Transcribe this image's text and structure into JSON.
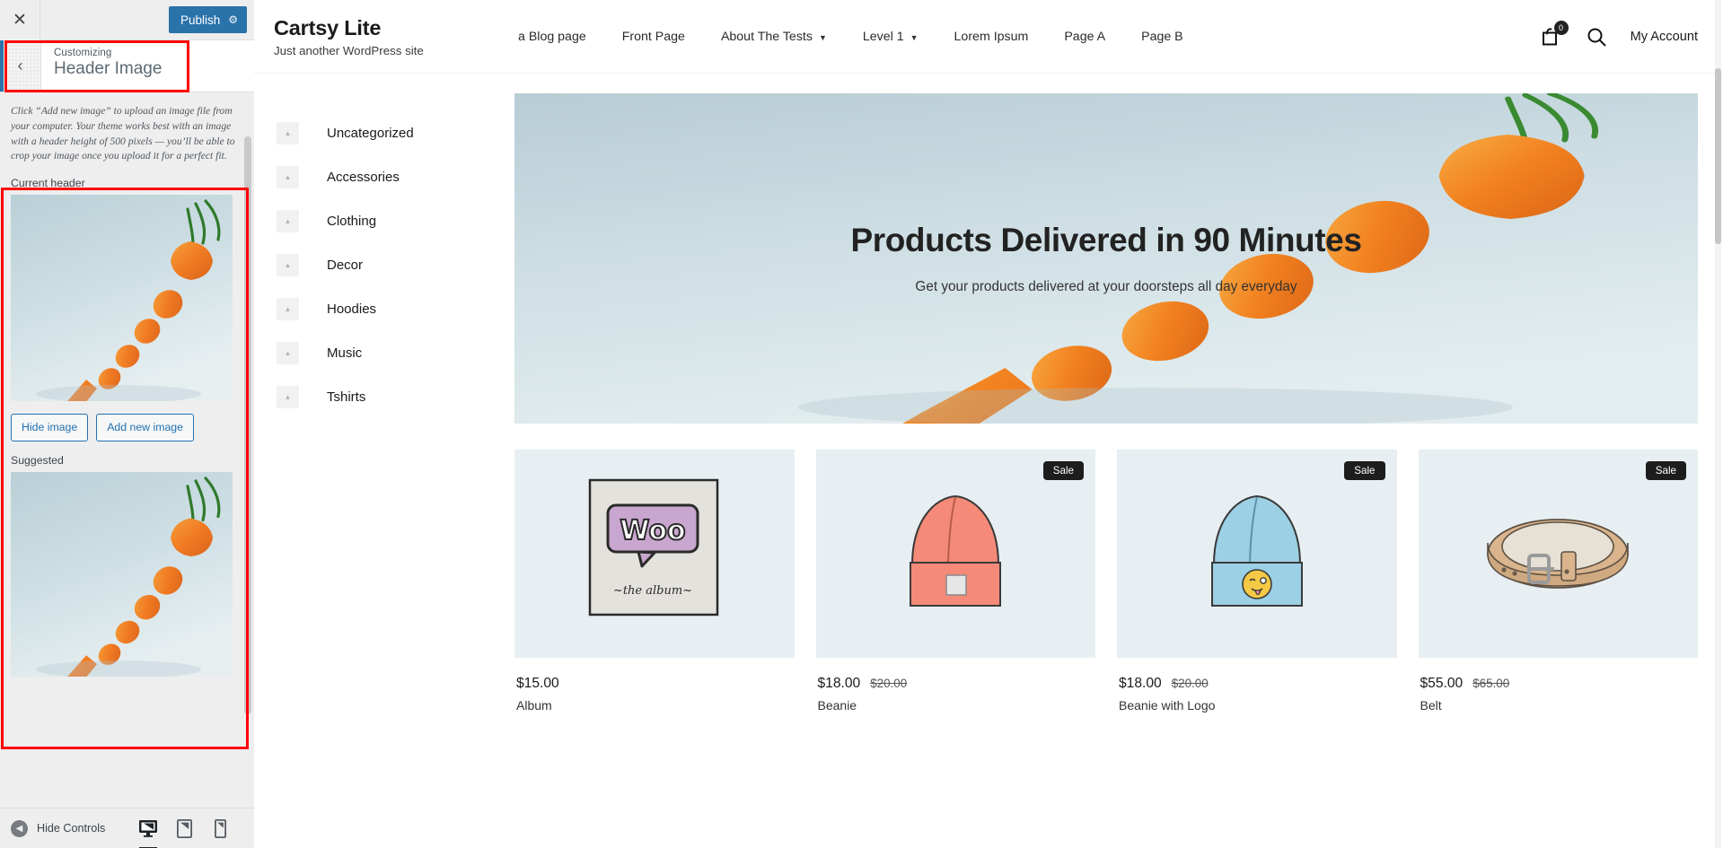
{
  "customizer": {
    "close_label": "✕",
    "publish_label": "Publish",
    "gear_icon": "gear-icon",
    "back_label": "‹",
    "customizing_label": "Customizing",
    "section_title": "Header Image",
    "description": "Click “Add new image” to upload an image file from your computer. Your theme works best with an image with a header height of 500 pixels — you’ll be able to crop your image once you upload it for a perfect fit.",
    "current_header_label": "Current header",
    "hide_image_label": "Hide image",
    "add_new_image_label": "Add new image",
    "suggested_label": "Suggested",
    "hide_controls_label": "Hide Controls",
    "devices": [
      {
        "name": "desktop-preview-icon",
        "label": "Desktop",
        "active": true
      },
      {
        "name": "tablet-preview-icon",
        "label": "Tablet",
        "active": false
      },
      {
        "name": "mobile-preview-icon",
        "label": "Mobile",
        "active": false
      }
    ],
    "accent_color": "#2a72aa",
    "highlight_color": "#ff0000"
  },
  "site": {
    "brand_name": "Cartsy Lite",
    "tagline": "Just another WordPress site",
    "nav": [
      {
        "label": "a Blog page",
        "has_caret": false
      },
      {
        "label": "Front Page",
        "has_caret": false
      },
      {
        "label": "About The Tests",
        "has_caret": true
      },
      {
        "label": "Level 1",
        "has_caret": true
      },
      {
        "label": "Lorem Ipsum",
        "has_caret": false
      },
      {
        "label": "Page A",
        "has_caret": false
      },
      {
        "label": "Page B",
        "has_caret": false
      }
    ],
    "cart_count": "0",
    "account_label": "My Account",
    "categories": [
      {
        "label": "Uncategorized"
      },
      {
        "label": "Accessories"
      },
      {
        "label": "Clothing"
      },
      {
        "label": "Decor"
      },
      {
        "label": "Hoodies"
      },
      {
        "label": "Music"
      },
      {
        "label": "Tshirts"
      }
    ],
    "hero": {
      "heading": "Products Delivered in 90 Minutes",
      "subheading": "Get your products delivered at your doorsteps all day everyday"
    },
    "products": [
      {
        "price": "$15.00",
        "old_price": "",
        "name": "Album",
        "sale": false,
        "type": "album"
      },
      {
        "price": "$18.00",
        "old_price": "$20.00",
        "name": "Beanie",
        "sale": true,
        "sale_label": "Sale",
        "type": "beanie-pink"
      },
      {
        "price": "$18.00",
        "old_price": "$20.00",
        "name": "Beanie with Logo",
        "sale": true,
        "sale_label": "Sale",
        "type": "beanie-blue"
      },
      {
        "price": "$55.00",
        "old_price": "$65.00",
        "name": "Belt",
        "sale": true,
        "sale_label": "Sale",
        "type": "belt"
      }
    ]
  }
}
